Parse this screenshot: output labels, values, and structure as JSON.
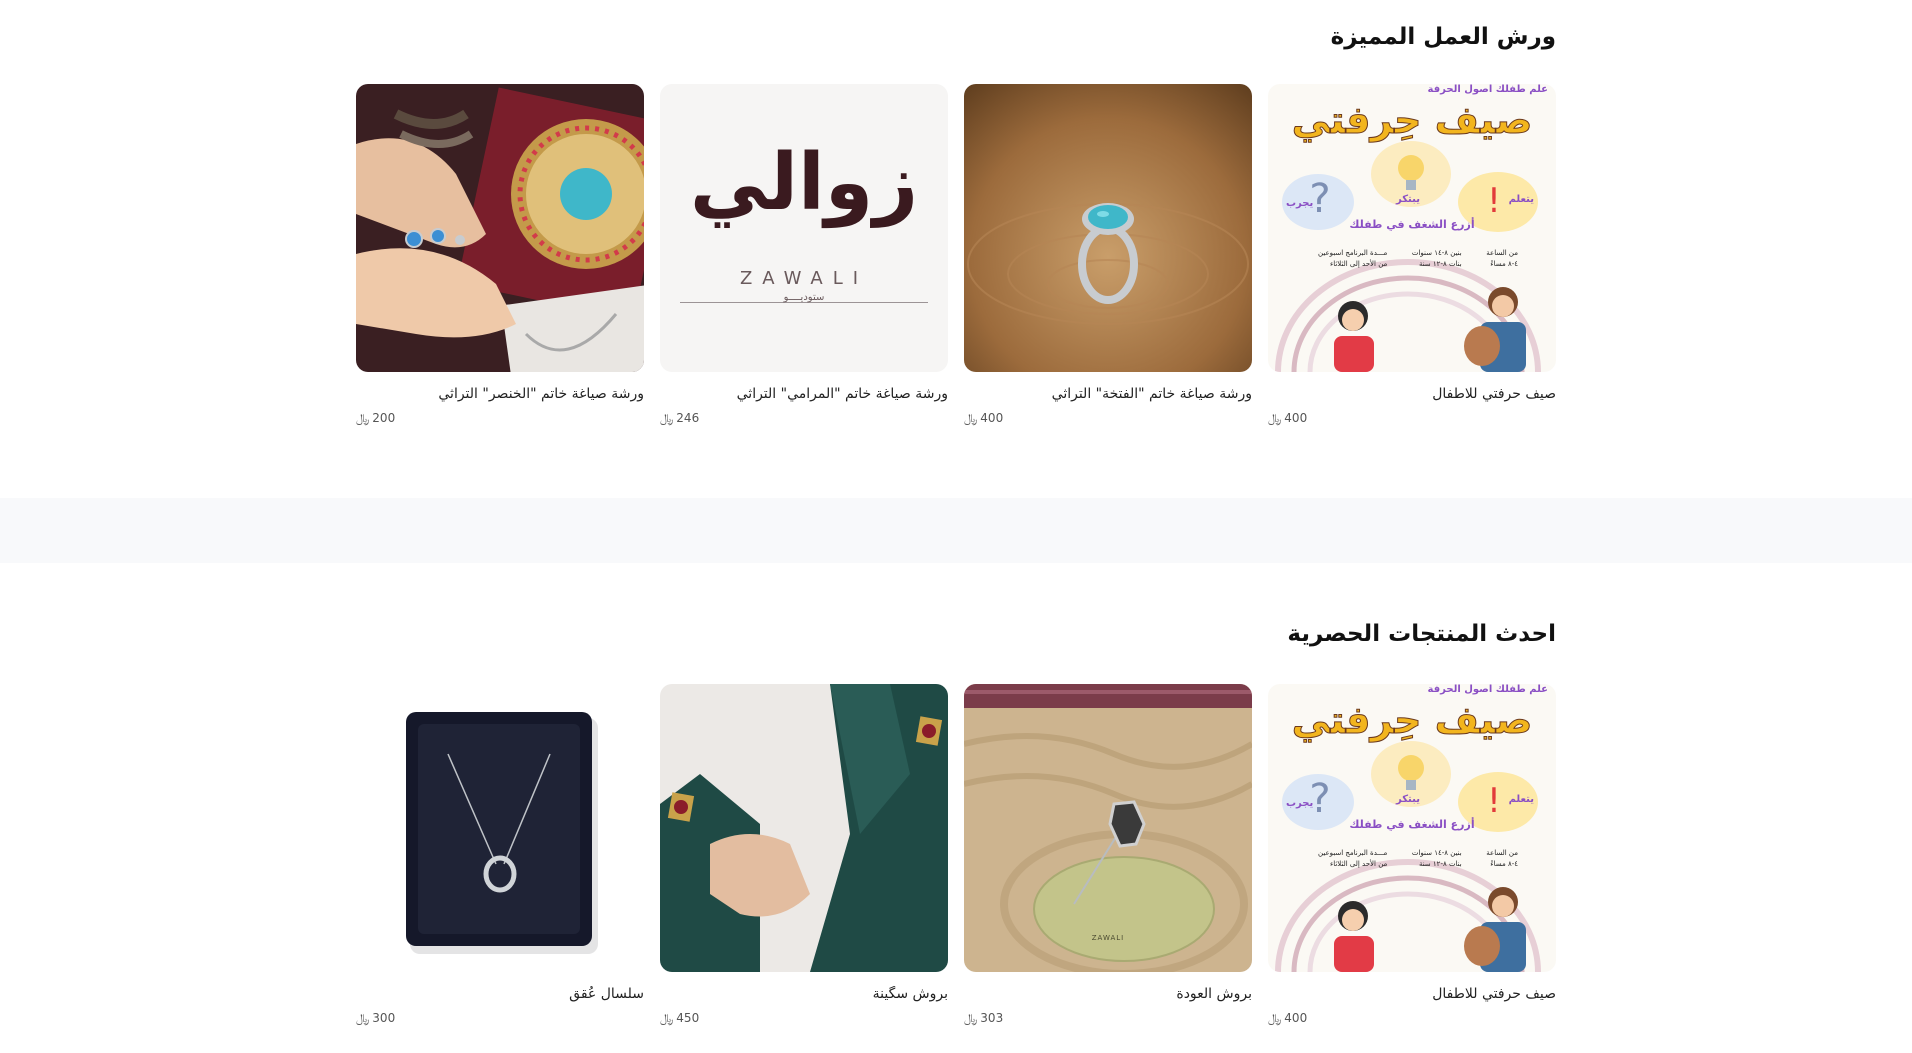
{
  "featured": {
    "title": "ورش العمل المميزة",
    "cards": [
      {
        "title": "صيف حرفتي للاطفال",
        "price": "400",
        "currency_symbol": "﷼",
        "image": "craft-summer-poster"
      },
      {
        "title": "ورشة صياغة خاتم \"الفتخة\" التراثي",
        "price": "400",
        "currency_symbol": "﷼",
        "image": "turquoise-ring-on-wood"
      },
      {
        "title": "ورشة صياغة خاتم \"المرامي\" التراثي",
        "price": "246",
        "currency_symbol": "﷼",
        "image": "zawali-logo"
      },
      {
        "title": "ورشة صياغة خاتم \"الخنصر\" التراثي",
        "price": "200",
        "currency_symbol": "﷼",
        "image": "hands-with-rings"
      }
    ]
  },
  "latest": {
    "title": "احدث المنتجات الحصرية",
    "cards": [
      {
        "title": "صيف حرفتي للاطفال",
        "price": "400",
        "currency_symbol": "﷼",
        "image": "craft-summer-poster"
      },
      {
        "title": "بروش العودة",
        "price": "303",
        "currency_symbol": "﷼",
        "image": "brooch-on-sand"
      },
      {
        "title": "بروش سگينة",
        "price": "450",
        "currency_symbol": "﷼",
        "image": "brooch-on-green-jacket"
      },
      {
        "title": "سلسال عُقق",
        "price": "300",
        "currency_symbol": "﷼",
        "image": "necklace-in-box"
      }
    ]
  },
  "poster": {
    "top_line": "علم طفلك اصول الحرفة",
    "headline": "صيف حِرفتي",
    "word_learn": "يتعلم",
    "word_create": "يبتكر",
    "word_try": "يجرب",
    "tagline": "أزرع الشغف في طفلك",
    "info_1a": "مـــدة البرنامج اسبوعين",
    "info_1b": "من الأحد إلى الثلاثاء",
    "info_2a": "بنين ٨-١٤ سنوات",
    "info_2b": "بنات ٨-١٢ سنة",
    "info_3a": "من الساعة",
    "info_3b": "٤-٨ مساءً"
  },
  "zawali_logo": {
    "arabic": "زوالي",
    "latin": "ZAWALI",
    "sub": "ستوديــــو"
  },
  "brooch_pouch": {
    "brand": "ZAWALI"
  }
}
